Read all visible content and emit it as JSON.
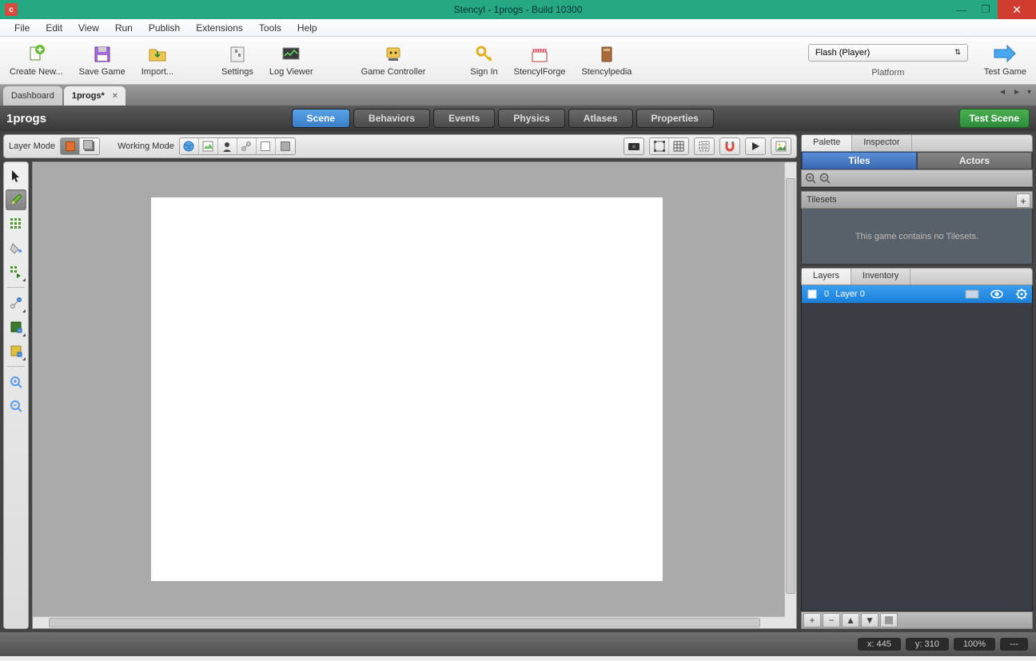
{
  "titlebar": {
    "text": "Stencyl - 1progs - Build 10300"
  },
  "menu": {
    "items": [
      "File",
      "Edit",
      "View",
      "Run",
      "Publish",
      "Extensions",
      "Tools",
      "Help"
    ]
  },
  "toolbar": {
    "create": "Create New...",
    "save": "Save Game",
    "import": "Import...",
    "settings": "Settings",
    "logviewer": "Log Viewer",
    "gamecontroller": "Game Controller",
    "signin": "Sign In",
    "stencylforge": "StencylForge",
    "stencylpedia": "Stencylpedia",
    "platform_value": "Flash (Player)",
    "platform_label": "Platform",
    "testgame": "Test Game"
  },
  "tabs": {
    "dashboard": "Dashboard",
    "active": "1progs*"
  },
  "scene": {
    "title": "1progs",
    "tabs": [
      "Scene",
      "Behaviors",
      "Events",
      "Physics",
      "Atlases",
      "Properties"
    ],
    "test": "Test Scene"
  },
  "sectoolbar": {
    "layermode": "Layer Mode",
    "workingmode": "Working Mode"
  },
  "right": {
    "palette": "Palette",
    "inspector": "Inspector",
    "tiles": "Tiles",
    "actors": "Actors",
    "tilesets": "Tilesets",
    "tilesets_empty": "This game contains no Tilesets.",
    "layers": "Layers",
    "inventory": "Inventory",
    "layer0_idx": "0",
    "layer0_name": "Layer 0"
  },
  "status": {
    "x": "x:     445",
    "y": "y:     310",
    "zoom": "100%",
    "extra": "---"
  }
}
